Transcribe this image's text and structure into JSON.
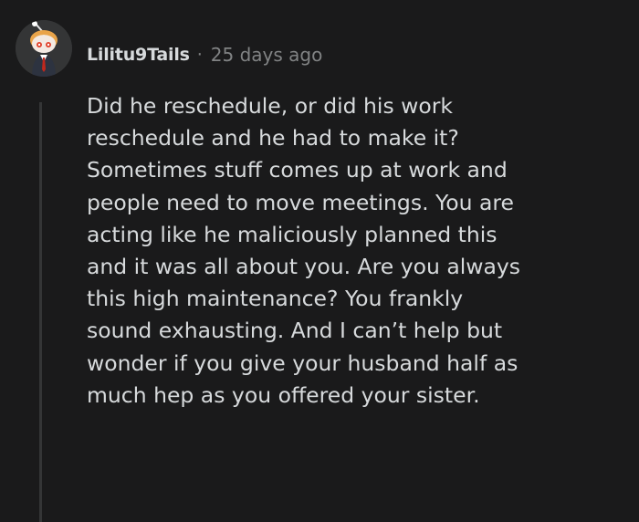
{
  "comment": {
    "author": "Lilitu9Tails",
    "separator": "·",
    "timestamp": "25 days ago",
    "avatar_icon": "snoo-avatar-icon",
    "body_lines": [
      "Did he reschedule, or did his work",
      "reschedule and he had to make it?",
      "Sometimes stuff comes up at work and",
      "people need to move meetings. You are",
      "acting like he maliciously planned this",
      "and it was all about you. Are you always",
      "this high maintenance? You frankly",
      "sound exhausting. And I can’t help but",
      "wonder if you give your husband half as",
      "much hep as you offered your sister."
    ]
  },
  "colors": {
    "background": "#1a1a1b",
    "text": "#d7dadc",
    "meta": "#818384",
    "thread_line": "#343536"
  }
}
